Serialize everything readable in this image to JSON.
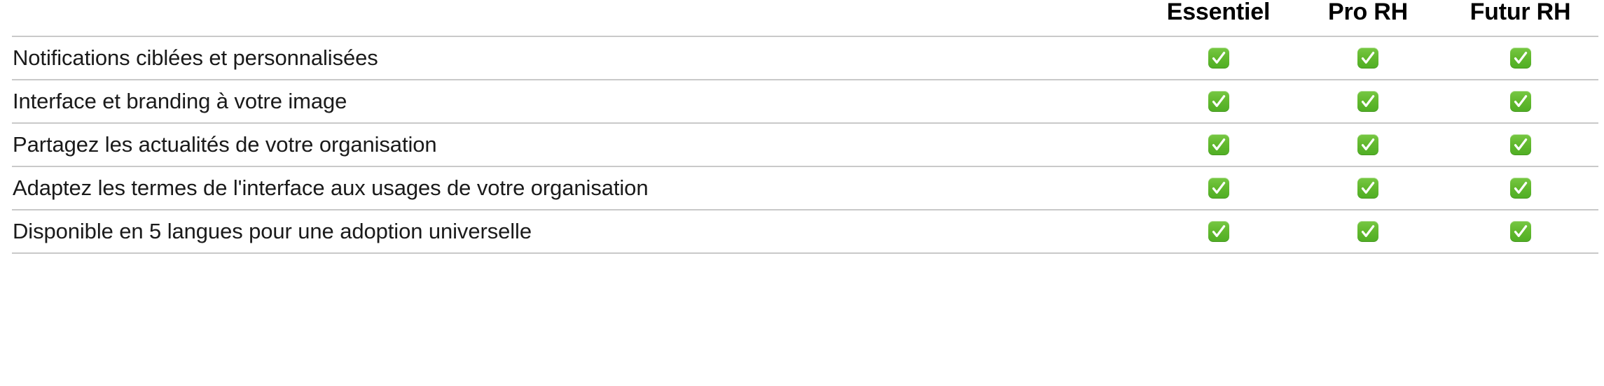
{
  "table": {
    "columns": {
      "feature_header": "",
      "plans": [
        "Essentiel",
        "Pro RH",
        "Futur RH"
      ]
    },
    "icons": {
      "check": "check-mark-button-icon"
    },
    "colors": {
      "check_green": "#63b92f",
      "check_glyph": "#ffffff",
      "divider": "#c9c9c9",
      "text": "#1a1a1a",
      "header_text": "#000000",
      "background": "#ffffff"
    },
    "rows": [
      {
        "feature": "Notifications ciblées et personnalisées",
        "values": [
          "✅",
          "✅",
          "✅"
        ]
      },
      {
        "feature": "Interface et branding à votre image",
        "values": [
          "✅",
          "✅",
          "✅"
        ]
      },
      {
        "feature": "Partagez les actualités de votre organisation",
        "values": [
          "✅",
          "✅",
          "✅"
        ]
      },
      {
        "feature": "Adaptez les termes de l'interface aux usages de votre organisation",
        "values": [
          "✅",
          "✅",
          "✅"
        ]
      },
      {
        "feature": "Disponible en 5 langues pour une adoption universelle",
        "values": [
          "✅",
          "✅",
          "✅"
        ]
      }
    ]
  }
}
